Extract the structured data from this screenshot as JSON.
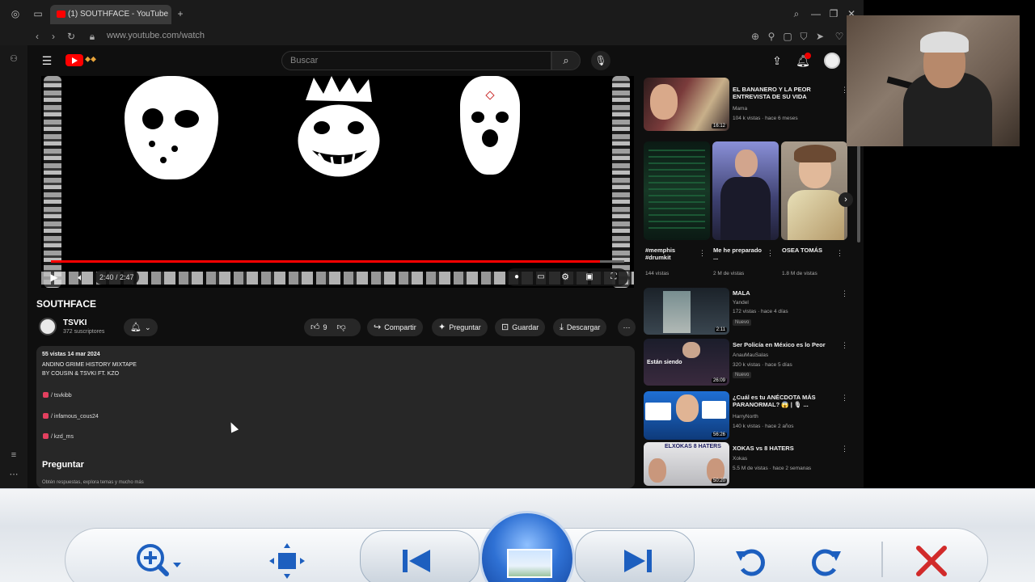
{
  "browser": {
    "tab_title": "(1) SOUTHFACE - YouTube",
    "url": "www.youtube.com/watch"
  },
  "youtube": {
    "search_placeholder": "Buscar",
    "notification_count": "1"
  },
  "player": {
    "time": "2:40 / 2:47",
    "progress": 0.958
  },
  "video": {
    "title": "SOUTHFACE",
    "channel_name": "TSVKI",
    "channel_subs": "372 suscriptores",
    "like_count": "9",
    "share_label": "Compartir",
    "ask_label": "Preguntar",
    "save_label": "Guardar",
    "download_label": "Descargar"
  },
  "description": {
    "meta": "55 vistas  14 mar 2024",
    "line1": "ANDINO GRIME HISTORY MIXTAPE",
    "line2": "BY COUSIN & TSVKI FT. KZO",
    "links": [
      "/ tsvkibb",
      "/ infamous_cous24",
      "/ kzd_ms"
    ],
    "ask_title": "Preguntar",
    "ask_sub": "Obtén respuestas, explora temas y mucho más"
  },
  "recommendations": [
    {
      "title": "EL BANANERO Y LA PEOR ENTREVISTA DE SU VIDA",
      "channel": "Mama",
      "meta": "104 k vistas · hace 6 meses",
      "duration": "16:12"
    },
    {
      "title": "MALA",
      "channel": "Yandel",
      "meta": "172 vistas · hace 4 días",
      "badge": "Nuevo",
      "duration": "2:11"
    },
    {
      "title": "Ser Policía en México es lo Peor",
      "channel": "AnauMauSalas",
      "meta": "320 k vistas · hace 5 días",
      "badge": "Nuevo",
      "duration": "26:09",
      "overlay": "Están siendo"
    },
    {
      "title": "¿Cuál es tu ANÉCDOTA MÁS PARANORMAL? 😱 | 🎙 ...",
      "channel": "HarryNorth",
      "meta": "140 k vistas · hace 2 años",
      "duration": "56:26"
    },
    {
      "title": "XOKAS vs 8 HATERS",
      "channel": "Xokas",
      "meta": "5.5 M de vistas · hace 2 semanas",
      "duration": "50:20",
      "overlay": "ELXOKAS 8 HATERS"
    }
  ],
  "shorts": [
    {
      "title": "#memphis #drumkit",
      "meta": "144 vistas"
    },
    {
      "title": "Me he preparado ...",
      "meta": "2 M de vistas"
    },
    {
      "title": "OSEA TOMÁS",
      "meta": "1.8 M de vistas"
    }
  ],
  "viewer_toolbar": {
    "buttons": [
      "zoom-icon",
      "fit-window-icon",
      "previous-icon",
      "slideshow-icon",
      "next-icon",
      "rotate-left-icon",
      "rotate-right-icon",
      "delete-icon"
    ]
  }
}
